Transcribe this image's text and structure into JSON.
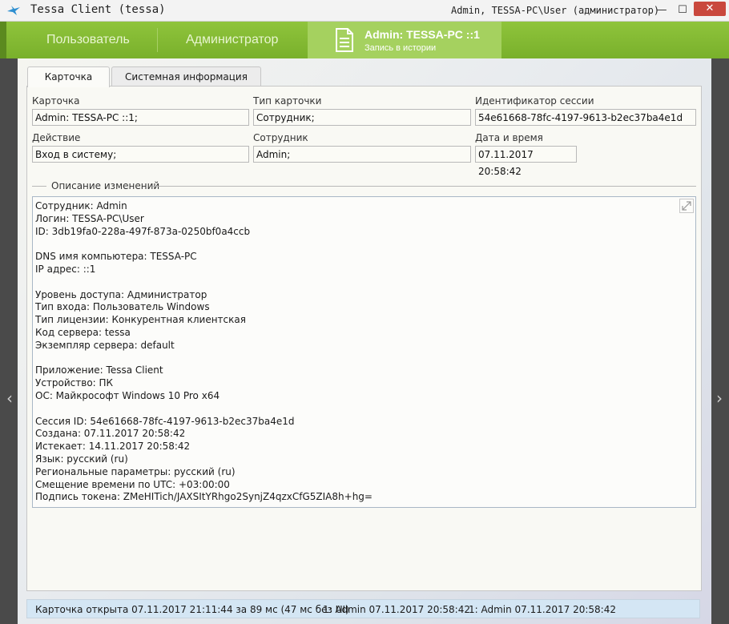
{
  "window": {
    "title": "Tessa Client (tessa)",
    "user": "Admin, TESSA-PC\\User (администратор)",
    "minimize": "—",
    "maximize": "☐",
    "close": "✕"
  },
  "nav": {
    "tab_user": "Пользователь",
    "tab_admin": "Администратор",
    "active_title": "Admin: TESSA-PC ::1",
    "active_subtitle": "Запись в истории"
  },
  "tabs": {
    "card": "Карточка",
    "system_info": "Системная информация"
  },
  "fields": {
    "card_label": "Карточка",
    "card_value": "Admin: TESSA-PC ::1;",
    "card_type_label": "Тип карточки",
    "card_type_value": "Сотрудник;",
    "session_id_label": "Идентификатор сессии",
    "session_id_value": "54e61668-78fc-4197-9613-b2ec37ba4e1d",
    "action_label": "Действие",
    "action_value": "Вход в систему;",
    "employee_label": "Сотрудник",
    "employee_value": "Admin;",
    "datetime_label": "Дата и время",
    "datetime_value": "07.11.2017  20:58:42"
  },
  "description": {
    "title": "Описание изменений",
    "lines": [
      "Сотрудник: Admin",
      "Логин: TESSA-PC\\User",
      "ID: 3db19fa0-228a-497f-873a-0250bf0a4ccb",
      "",
      "DNS имя компьютера: TESSA-PC",
      "IP адрес: ::1",
      "",
      "Уровень доступа: Администратор",
      "Тип входа: Пользователь Windows",
      "Тип лицензии: Конкурентная клиентская",
      "Код сервера: tessa",
      "Экземпляр сервера: default",
      "",
      "Приложение: Tessa Client",
      "Устройство: ПК",
      "ОС: Майкрософт Windows 10 Pro x64",
      "",
      "Сессия ID: 54e61668-78fc-4197-9613-b2ec37ba4e1d",
      "Создана: 07.11.2017 20:58:42",
      "Истекает: 14.11.2017 20:58:42",
      "Язык: русский (ru)",
      "Региональные параметры: русский (ru)",
      "Смещение времени по UTC: +03:00:00",
      "Подпись токена: ZMeHITich/JAXSItYRhgo2SynjZ4qzxCfG5ZIA8h+hg="
    ]
  },
  "status": {
    "opened": "Карточка открыта 07.11.2017 21:11:44 за 89 мс (47 мс без UI)",
    "item1": "1:  Admin  07.11.2017 20:58:42",
    "item2": "1:  Admin  07.11.2017 20:58:42"
  },
  "icons": {
    "app": "tessa-bird-icon",
    "document": "document-icon",
    "expand": "expand-icon",
    "left": "chevron-left-icon",
    "right": "chevron-right-icon"
  },
  "colors": {
    "accent_green": "#8fc43c",
    "active_tab_green": "#a5d15f",
    "status_bar": "#d4e6f4"
  }
}
